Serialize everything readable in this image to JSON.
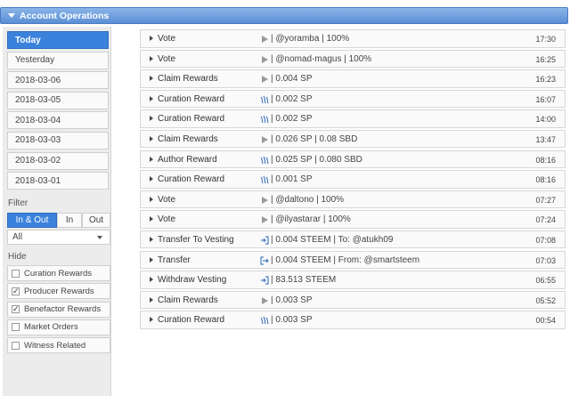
{
  "header": {
    "title": "Account Operations"
  },
  "sidebar": {
    "dates": [
      "Today",
      "Yesterday",
      "2018-03-06",
      "2018-03-05",
      "2018-03-04",
      "2018-03-03",
      "2018-03-02",
      "2018-03-01"
    ],
    "active_date_index": 0,
    "filter_label": "Filter",
    "filter_tabs": [
      "In & Out",
      "In",
      "Out"
    ],
    "active_filter_index": 0,
    "select_value": "All",
    "hide_label": "Hide",
    "hide_items": [
      {
        "label": "Curation Rewards",
        "checked": false
      },
      {
        "label": "Producer Rewards",
        "checked": true
      },
      {
        "label": "Benefactor Rewards",
        "checked": true
      },
      {
        "label": "Market Orders",
        "checked": false
      },
      {
        "label": "Witness Related",
        "checked": false
      }
    ]
  },
  "operations": [
    {
      "type": "Vote",
      "icon": "play-icon",
      "detail": "| @yoramba | 100%",
      "time": "17:30"
    },
    {
      "type": "Vote",
      "icon": "play-icon",
      "detail": "| @nomad-magus | 100%",
      "time": "16:25"
    },
    {
      "type": "Claim Rewards",
      "icon": "play-icon",
      "detail": "| 0.004 SP",
      "time": "16:23"
    },
    {
      "type": "Curation Reward",
      "icon": "steem-icon",
      "detail": "| 0.002 SP",
      "time": "16:07"
    },
    {
      "type": "Curation Reward",
      "icon": "steem-icon",
      "detail": "| 0.002 SP",
      "time": "14:00"
    },
    {
      "type": "Claim Rewards",
      "icon": "play-icon",
      "detail": "| 0.026 SP | 0.08 SBD",
      "time": "13:47"
    },
    {
      "type": "Author Reward",
      "icon": "steem-icon",
      "detail": "| 0.025 SP | 0.080 SBD",
      "time": "08:16"
    },
    {
      "type": "Curation Reward",
      "icon": "steem-icon",
      "detail": "| 0.001 SP",
      "time": "08:16"
    },
    {
      "type": "Vote",
      "icon": "play-icon",
      "detail": "| @daltono | 100%",
      "time": "07:27"
    },
    {
      "type": "Vote",
      "icon": "play-icon",
      "detail": "| @ilyastarar | 100%",
      "time": "07:24"
    },
    {
      "type": "Transfer To Vesting",
      "icon": "sign-in-icon",
      "detail": "| 0.004 STEEM | To: @atukh09",
      "time": "07:08"
    },
    {
      "type": "Transfer",
      "icon": "sign-out-icon",
      "detail": "| 0.004 STEEM | From: @smartsteem",
      "time": "07:03"
    },
    {
      "type": "Withdraw Vesting",
      "icon": "sign-in-icon",
      "detail": "| 83.513 STEEM",
      "time": "06:55"
    },
    {
      "type": "Claim Rewards",
      "icon": "play-icon",
      "detail": "| 0.003 SP",
      "time": "05:52"
    },
    {
      "type": "Curation Reward",
      "icon": "steem-icon",
      "detail": "| 0.003 SP",
      "time": "00:54"
    }
  ],
  "colors": {
    "accent": "#3b82dc",
    "header": "#6b9ddd",
    "play_icon": "#999999",
    "steem_icon": "#4a7cc4"
  }
}
